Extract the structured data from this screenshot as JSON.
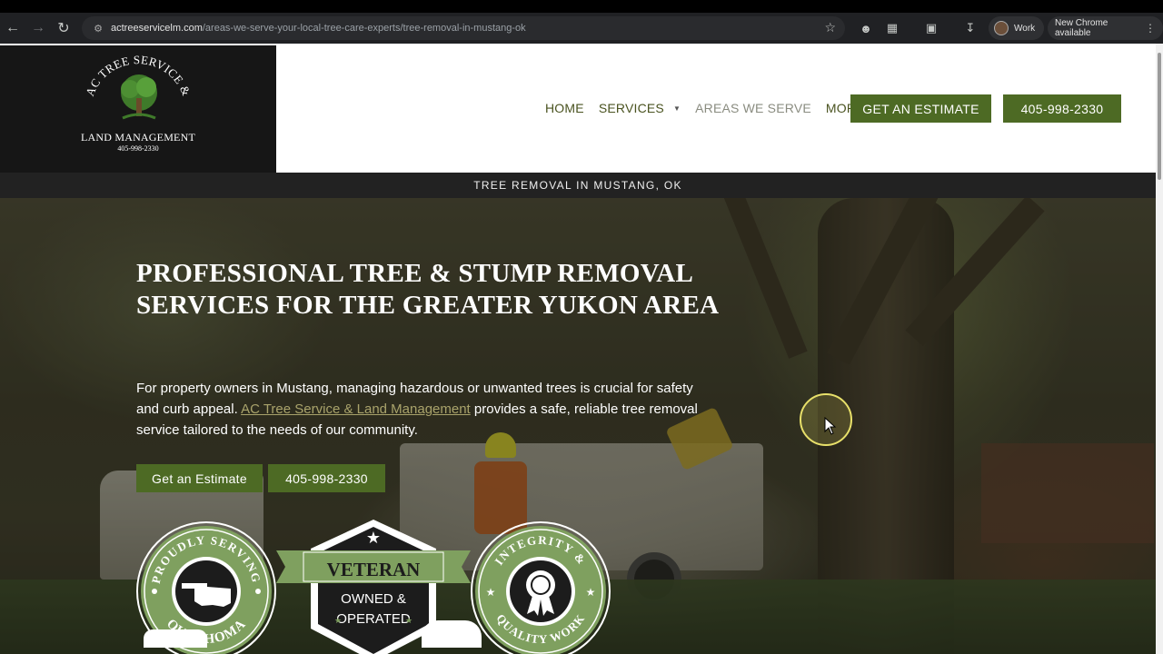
{
  "browser": {
    "url_domain": "actreeservicelm.com",
    "url_path": "/areas-we-serve-your-local-tree-care-experts/tree-removal-in-mustang-ok",
    "profile_label": "Work",
    "update_label": "New Chrome available",
    "icons": [
      "back-arrow-icon",
      "forward-arrow-icon",
      "reload-icon",
      "site-info-icon",
      "star-icon",
      "extension-icon",
      "puzzle-icon",
      "tab-search-icon",
      "download-icon",
      "kebab-menu-icon"
    ]
  },
  "logo": {
    "name_line1": "AC TREE SERVICE &",
    "name_line2": "LAND MANAGEMENT",
    "phone": "405-998-2330"
  },
  "nav": {
    "items": [
      {
        "label": "HOME",
        "has_dropdown": false,
        "active": false
      },
      {
        "label": "SERVICES",
        "has_dropdown": true,
        "active": false
      },
      {
        "label": "AREAS WE SERVE",
        "has_dropdown": false,
        "active": true
      },
      {
        "label": "MORE",
        "has_dropdown": true,
        "active": false
      }
    ],
    "estimate_button": "GET AN ESTIMATE",
    "phone_button": "405-998-2330"
  },
  "breadcrumb": "TREE REMOVAL IN MUSTANG, OK",
  "hero": {
    "title_line1": "PROFESSIONAL TREE & STUMP REMOVAL",
    "title_line2": "SERVICES FOR THE GREATER YUKON AREA",
    "text_before": "For property owners in Mustang, managing hazardous or unwanted trees is crucial for safety and curb appeal. ",
    "text_link": "AC Tree Service & Land Management",
    "text_after": " provides a safe, reliable tree removal service tailored to the needs of our community.",
    "estimate_button": "Get an Estimate",
    "phone_button": "405-998-2330"
  },
  "badges": {
    "badge1": {
      "top": "PROUDLY SERVING",
      "bottom": "OKLAHOMA"
    },
    "badge2": {
      "banner": "VETERAN",
      "line1": "OWNED &",
      "line2": "OPERATED"
    },
    "badge3": {
      "top": "INTEGRITY &",
      "bottom": "QUALITY WORK"
    }
  },
  "colors": {
    "brand_green": "#4d6a24",
    "nav_text": "#4a5320",
    "badge_green": "#7fa05f",
    "header_dark": "#161616"
  }
}
